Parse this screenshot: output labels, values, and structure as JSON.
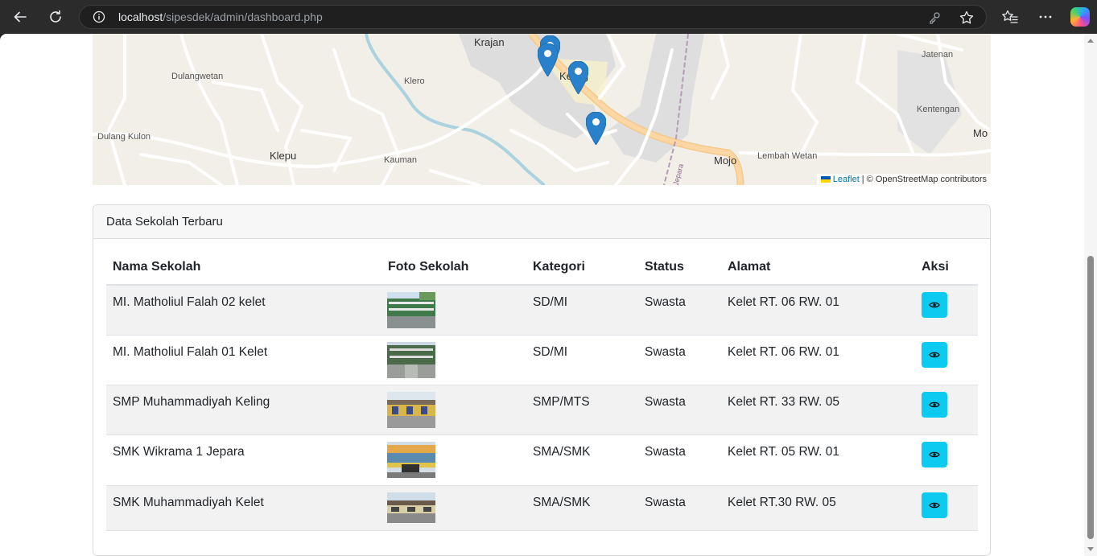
{
  "browser": {
    "url_host": "localhost",
    "url_path": "/sipesdek/admin/dashboard.php"
  },
  "map": {
    "labels": {
      "krajan": "Krajan",
      "dulangwetan": "Dulangwetan",
      "klero": "Klero",
      "keling": "Keling",
      "jatenan": "Jatenan",
      "kentengan": "Kentengan",
      "mo": "Mo",
      "dulang_kulon": "Dulang Kulon",
      "klepu": "Klepu",
      "kauman": "Kauman",
      "mojo": "Mojo",
      "lembah_wetan": "Lembah Wetan",
      "jepara_road": "Jepara"
    },
    "attribution": {
      "leaflet": "Leaflet",
      "separator": "|",
      "osm": "© OpenStreetMap contributors"
    },
    "marker_color": "#2a81cb",
    "marker_count": 5
  },
  "card": {
    "title": "Data Sekolah Terbaru",
    "columns": [
      "Nama Sekolah",
      "Foto Sekolah",
      "Kategori",
      "Status",
      "Alamat",
      "Aksi"
    ],
    "rows": [
      {
        "nama": "MI. Matholiul Falah 02 kelet",
        "kategori": "SD/MI",
        "status": "Swasta",
        "alamat": "Kelet RT. 06 RW. 01"
      },
      {
        "nama": "MI. Matholiul Falah 01 Kelet",
        "kategori": "SD/MI",
        "status": "Swasta",
        "alamat": "Kelet RT. 06 RW. 01"
      },
      {
        "nama": "SMP Muhammadiyah Keling",
        "kategori": "SMP/MTS",
        "status": "Swasta",
        "alamat": "Kelet RT. 33 RW. 05"
      },
      {
        "nama": "SMK Wikrama 1 Jepara",
        "kategori": "SMA/SMK",
        "status": "Swasta",
        "alamat": "Kelet RT. 05 RW. 01"
      },
      {
        "nama": "SMK Muhammadiyah Kelet",
        "kategori": "SMA/SMK",
        "status": "Swasta",
        "alamat": "Kelet RT.30 RW. 05"
      }
    ],
    "action_icon": "eye-icon",
    "action_color": "#0dcaf0"
  }
}
